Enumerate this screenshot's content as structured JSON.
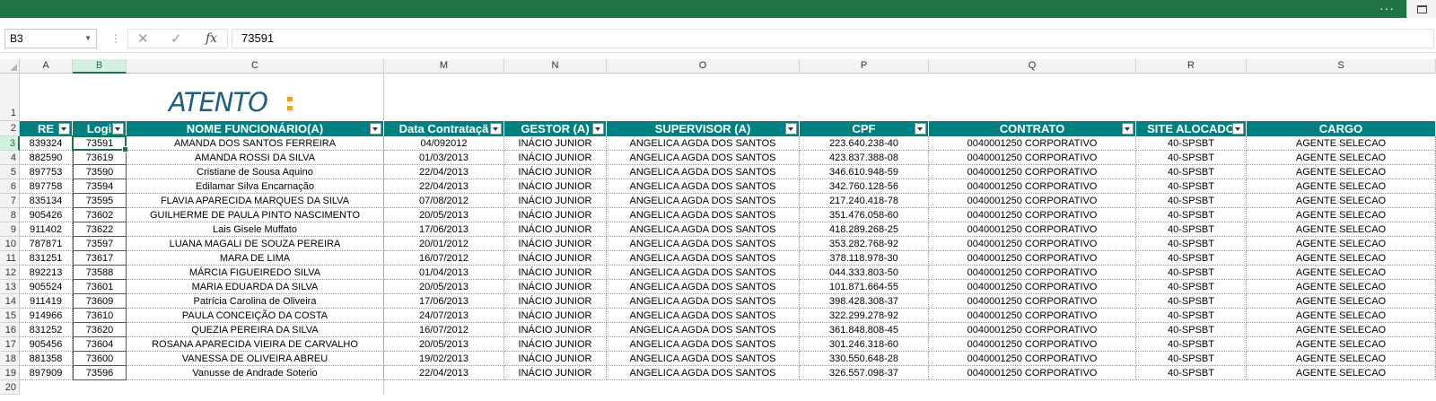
{
  "window": {
    "more_label": "···"
  },
  "formula_bar": {
    "name_box": "B3",
    "value": "73591",
    "cancel_symbol": "✕",
    "enter_symbol": "✓",
    "fx_label": "fx"
  },
  "columns": [
    "A",
    "B",
    "C",
    "M",
    "N",
    "O",
    "P",
    "Q",
    "R",
    "S"
  ],
  "rows": [
    "1",
    "2",
    "3",
    "4",
    "5",
    "6",
    "7",
    "8",
    "9",
    "10",
    "11",
    "12",
    "13",
    "14",
    "15",
    "16",
    "17",
    "18",
    "19",
    "20"
  ],
  "logo": {
    "text": "ATENTO"
  },
  "table": {
    "headers": [
      "RE",
      "Logi",
      "NOME FUNCIONÁRIO(A)",
      "Data Contrataçã",
      "GESTOR (A)",
      "SUPERVISOR (A)",
      "CPF",
      "CONTRATO",
      "SITE ALOCADO",
      "CARGO"
    ],
    "rows": [
      [
        "839324",
        "73591",
        "AMANDA DOS SANTOS FERREIRA",
        "04/092012",
        "INÁCIO JUNIOR",
        "ANGELICA AGDA DOS SANTOS",
        "223.640.238-40",
        "0040001250 CORPORATIVO",
        "40-SPSBT",
        "AGENTE SELECAO"
      ],
      [
        "882590",
        "73619",
        "AMANDA ROSSI DA SILVA",
        "01/03/2013",
        "INÁCIO JUNIOR",
        "ANGELICA AGDA DOS SANTOS",
        "423.837.388-08",
        "0040001250 CORPORATIVO",
        "40-SPSBT",
        "AGENTE SELECAO"
      ],
      [
        "897753",
        "73590",
        "Cristiane de Sousa Aquino",
        "22/04/2013",
        "INÁCIO JUNIOR",
        "ANGELICA AGDA DOS SANTOS",
        "346.610.948-59",
        "0040001250 CORPORATIVO",
        "40-SPSBT",
        "AGENTE SELECAO"
      ],
      [
        "897758",
        "73594",
        "Edilamar Silva Encarnação",
        "22/04/2013",
        "INÁCIO JUNIOR",
        "ANGELICA AGDA DOS SANTOS",
        "342.760.128-56",
        "0040001250 CORPORATIVO",
        "40-SPSBT",
        "AGENTE SELECAO"
      ],
      [
        "835134",
        "73595",
        "FLAVIA APARECIDA MARQUES DA SILVA",
        "07/08/2012",
        "INÁCIO JUNIOR",
        "ANGELICA AGDA DOS SANTOS",
        "217.240.418-78",
        "0040001250 CORPORATIVO",
        "40-SPSBT",
        "AGENTE SELECAO"
      ],
      [
        "905426",
        "73602",
        "GUILHERME DE PAULA PINTO NASCIMENTO",
        "20/05/2013",
        "INÁCIO JUNIOR",
        "ANGELICA AGDA DOS SANTOS",
        "351.476.058-60",
        "0040001250 CORPORATIVO",
        "40-SPSBT",
        "AGENTE SELECAO"
      ],
      [
        "911402",
        "73622",
        "Lais Gisele Muffato",
        "17/06/2013",
        "INÁCIO JUNIOR",
        "ANGELICA AGDA DOS SANTOS",
        "418.289.268-25",
        "0040001250 CORPORATIVO",
        "40-SPSBT",
        "AGENTE SELECAO"
      ],
      [
        "787871",
        "73597",
        "LUANA MAGALI DE SOUZA PEREIRA",
        "20/01/2012",
        "INÁCIO JUNIOR",
        "ANGELICA AGDA DOS SANTOS",
        "353.282.768-92",
        "0040001250 CORPORATIVO",
        "40-SPSBT",
        "AGENTE SELECAO"
      ],
      [
        "831251",
        "73617",
        "MARA DE LIMA",
        "16/07/2012",
        "INÁCIO JUNIOR",
        "ANGELICA AGDA DOS SANTOS",
        "378.118.978-30",
        "0040001250 CORPORATIVO",
        "40-SPSBT",
        "AGENTE SELECAO"
      ],
      [
        "892213",
        "73588",
        "MÁRCIA FIGUEIREDO SILVA",
        "01/04/2013",
        "INÁCIO JUNIOR",
        "ANGELICA AGDA DOS SANTOS",
        "044.333.803-50",
        "0040001250 CORPORATIVO",
        "40-SPSBT",
        "AGENTE SELECAO"
      ],
      [
        "905524",
        "73601",
        "MARIA EDUARDA DA SILVA",
        "20/05/2013",
        "INÁCIO JUNIOR",
        "ANGELICA AGDA DOS SANTOS",
        "101.871.664-55",
        "0040001250 CORPORATIVO",
        "40-SPSBT",
        "AGENTE SELECAO"
      ],
      [
        "911419",
        "73609",
        "Patrícia Carolina de Oliveira",
        "17/06/2013",
        "INÁCIO JUNIOR",
        "ANGELICA AGDA DOS SANTOS",
        "398.428.308-37",
        "0040001250 CORPORATIVO",
        "40-SPSBT",
        "AGENTE SELECAO"
      ],
      [
        "914966",
        "73610",
        "PAULA CONCEIÇÃO DA COSTA",
        "24/07/2013",
        "INÁCIO JUNIOR",
        "ANGELICA AGDA DOS SANTOS",
        "322.299.278-92",
        "0040001250 CORPORATIVO",
        "40-SPSBT",
        "AGENTE SELECAO"
      ],
      [
        "831252",
        "73620",
        "QUEZIA PEREIRA DA SILVA",
        "16/07/2012",
        "INÁCIO JUNIOR",
        "ANGELICA AGDA DOS SANTOS",
        "361.848.808-45",
        "0040001250 CORPORATIVO",
        "40-SPSBT",
        "AGENTE SELECAO"
      ],
      [
        "905456",
        "73604",
        "ROSANA APARECIDA VIEIRA DE CARVALHO",
        "20/05/2013",
        "INÁCIO JUNIOR",
        "ANGELICA AGDA DOS SANTOS",
        "301.246.318-60",
        "0040001250 CORPORATIVO",
        "40-SPSBT",
        "AGENTE SELECAO"
      ],
      [
        "881358",
        "73600",
        "VANESSA DE OLIVEIRA ABREU",
        "19/02/2013",
        "INÁCIO JUNIOR",
        "ANGELICA AGDA DOS SANTOS",
        "330.550.648-28",
        "0040001250 CORPORATIVO",
        "40-SPSBT",
        "AGENTE SELECAO"
      ],
      [
        "897909",
        "73596",
        "Vanusse de Andrade Soterio",
        "22/04/2013",
        "INÁCIO JUNIOR",
        "ANGELICA AGDA DOS SANTOS",
        "326.557.098-37",
        "0040001250 CORPORATIVO",
        "40-SPSBT",
        "AGENTE SELECAO"
      ]
    ]
  },
  "colors": {
    "accent": "#217346",
    "header_fill": "#008080",
    "logo": "#1f5f7f",
    "logo_dot": "#f5a01a"
  }
}
